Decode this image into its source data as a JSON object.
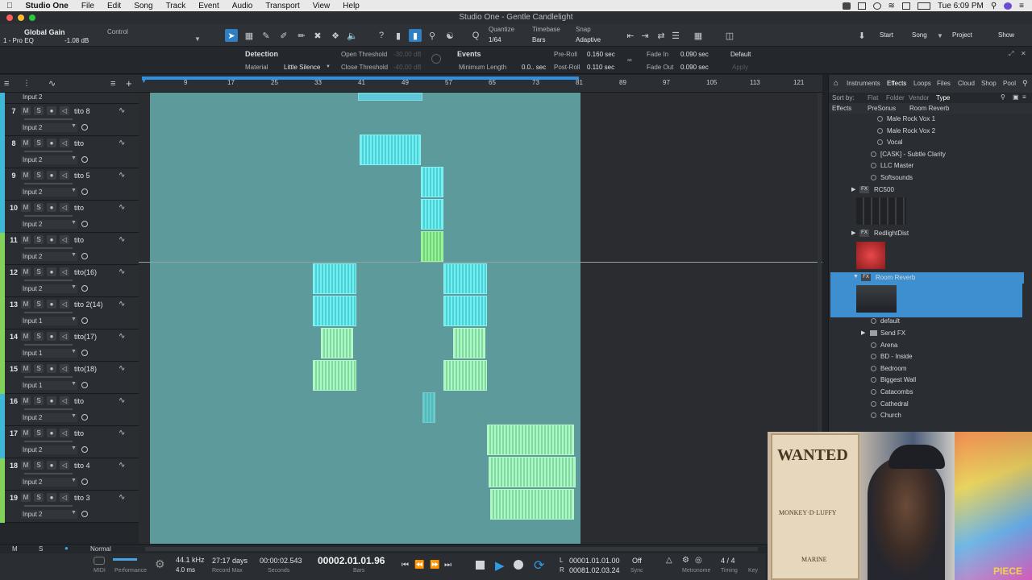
{
  "menubar": {
    "app": "Studio One",
    "items": [
      "File",
      "Edit",
      "Song",
      "Track",
      "Event",
      "Audio",
      "Transport",
      "View",
      "Help"
    ],
    "clock": "Tue 6:09 PM"
  },
  "window": {
    "title": "Studio One - Gentle Candlelight"
  },
  "toolbar": {
    "global_gain": "Global Gain",
    "control": "Control",
    "pro_eq": "1 - Pro EQ",
    "gain_val": "-1.08 dB",
    "quantize_label": "Quantize",
    "quantize_val": "1/64",
    "timebase_label": "Timebase",
    "timebase_val": "Bars",
    "snap_label": "Snap",
    "snap_val": "Adaptive",
    "start": "Start",
    "song": "Song",
    "project": "Project",
    "show": "Show"
  },
  "strip": {
    "detection": "Detection",
    "material_label": "Material",
    "material_val": "Little Silence",
    "open_threshold": "Open Threshold",
    "close_threshold": "Close Threshold",
    "open_val": "-30.00 dB",
    "close_val": "-40.00 dB",
    "events": "Events",
    "min_length_label": "Minimum Length",
    "min_length_val": "0.0.. sec",
    "preroll_label": "Pre-Roll",
    "preroll_val": "0.160 sec",
    "postroll_label": "Post-Roll",
    "postroll_val": "0.110 sec",
    "fadein_label": "Fade In",
    "fadein_val": "0.090 sec",
    "fadeout_label": "Fade Out",
    "fadeout_val": "0.090 sec",
    "default": "Default",
    "apply": "Apply"
  },
  "ruler": [
    "9",
    "17",
    "25",
    "33",
    "41",
    "49",
    "57",
    "65",
    "73",
    "81",
    "89",
    "97",
    "105",
    "113",
    "121"
  ],
  "tracks": [
    {
      "num": "7",
      "name": "tito 8",
      "input": "Input 2",
      "color": "#3fb8d8"
    },
    {
      "num": "8",
      "name": "tito",
      "input": "Input 2",
      "color": "#3fb8d8"
    },
    {
      "num": "9",
      "name": "tito 5",
      "input": "Input 2",
      "color": "#3fb8d8"
    },
    {
      "num": "10",
      "name": "tito",
      "input": "Input 2",
      "color": "#3fb8d8"
    },
    {
      "num": "11",
      "name": "tito",
      "input": "Input 2",
      "color": "#82d15a"
    },
    {
      "num": "12",
      "name": "tito(16)",
      "input": "Input 2",
      "color": "#82d15a"
    },
    {
      "num": "13",
      "name": "tito 2(14)",
      "input": "Input 1",
      "color": "#82d15a"
    },
    {
      "num": "14",
      "name": "tito(17)",
      "input": "Input 1",
      "color": "#82d15a"
    },
    {
      "num": "15",
      "name": "tito(18)",
      "input": "Input 1",
      "color": "#82d15a"
    },
    {
      "num": "16",
      "name": "tito",
      "input": "Input 2",
      "color": "#3fb8d8"
    },
    {
      "num": "17",
      "name": "tito",
      "input": "Input 2",
      "color": "#3fb8d8"
    },
    {
      "num": "18",
      "name": "tito 4",
      "input": "Input 2",
      "color": "#82d15a"
    },
    {
      "num": "19",
      "name": "tito 3",
      "input": "Input 2",
      "color": "#82d15a"
    }
  ],
  "first_partial_input": "Input 2",
  "footer": {
    "m": "M",
    "s": "S",
    "mode": "Normal"
  },
  "transport": {
    "midi": "MIDI",
    "performance": "Performance",
    "samplerate": "44.1 kHz",
    "latency": "4.0 ms",
    "record_max_val": "27:17 days",
    "record_max_label": "Record Max",
    "seconds_val": "00:00:02.543",
    "seconds_label": "Seconds",
    "position": "00002.01.01.96",
    "bars_label": "Bars",
    "loop_start": "00001.01.01.00",
    "loop_end": "00081.02.03.24",
    "sync_val": "Off",
    "sync_label": "Sync",
    "metronome": "Metronome",
    "timing": "Timing",
    "signature": "4 / 4",
    "key": "Key"
  },
  "browser": {
    "tabs": [
      "Instruments",
      "Effects",
      "Loops",
      "Files",
      "Cloud",
      "Shop",
      "Pool"
    ],
    "active_tab": "Effects",
    "sort_by": "Sort by:",
    "sort_opts": [
      "Flat",
      "Folder",
      "Vendor",
      "Type"
    ],
    "path": [
      "Effects",
      "PreSonus",
      "Room Reverb"
    ],
    "items": [
      {
        "label": "Male Rock Vox 1",
        "indent": 2,
        "kind": "preset"
      },
      {
        "label": "Male Rock Vox 2",
        "indent": 2,
        "kind": "preset"
      },
      {
        "label": "Vocal",
        "indent": 2,
        "kind": "preset"
      },
      {
        "label": "[CASK] - Subtle Clarity",
        "indent": 1,
        "kind": "preset"
      },
      {
        "label": "LLC Master",
        "indent": 1,
        "kind": "preset"
      },
      {
        "label": "Softsounds",
        "indent": 1,
        "kind": "preset"
      },
      {
        "label": "RC500",
        "indent": 0,
        "kind": "fx"
      },
      {
        "label": "RedlightDist",
        "indent": 0,
        "kind": "fx"
      },
      {
        "label": "Room Reverb",
        "indent": 0,
        "kind": "fx-selected"
      },
      {
        "label": "default",
        "indent": 1,
        "kind": "preset"
      },
      {
        "label": "Send FX",
        "indent": 1,
        "kind": "folder"
      },
      {
        "label": "Arena",
        "indent": 1,
        "kind": "preset"
      },
      {
        "label": "BD - Inside",
        "indent": 1,
        "kind": "preset"
      },
      {
        "label": "Bedroom",
        "indent": 1,
        "kind": "preset"
      },
      {
        "label": "Biggest Wall",
        "indent": 1,
        "kind": "preset"
      },
      {
        "label": "Catacombs",
        "indent": 1,
        "kind": "preset"
      },
      {
        "label": "Cathedral",
        "indent": 1,
        "kind": "preset"
      },
      {
        "label": "Church",
        "indent": 1,
        "kind": "preset"
      }
    ]
  },
  "colors": {
    "accent": "#2f7fc4",
    "clip_cyan": "#6cf0f2",
    "clip_green": "#97f295",
    "range": "#5c9a9b",
    "selected_row": "#3d8fcf"
  },
  "webcam": {
    "poster_text": "WANTED",
    "poster_name": "MONKEY·D·LUFFY",
    "marine_text": "MARINE",
    "sticker_text": "PIECE"
  }
}
